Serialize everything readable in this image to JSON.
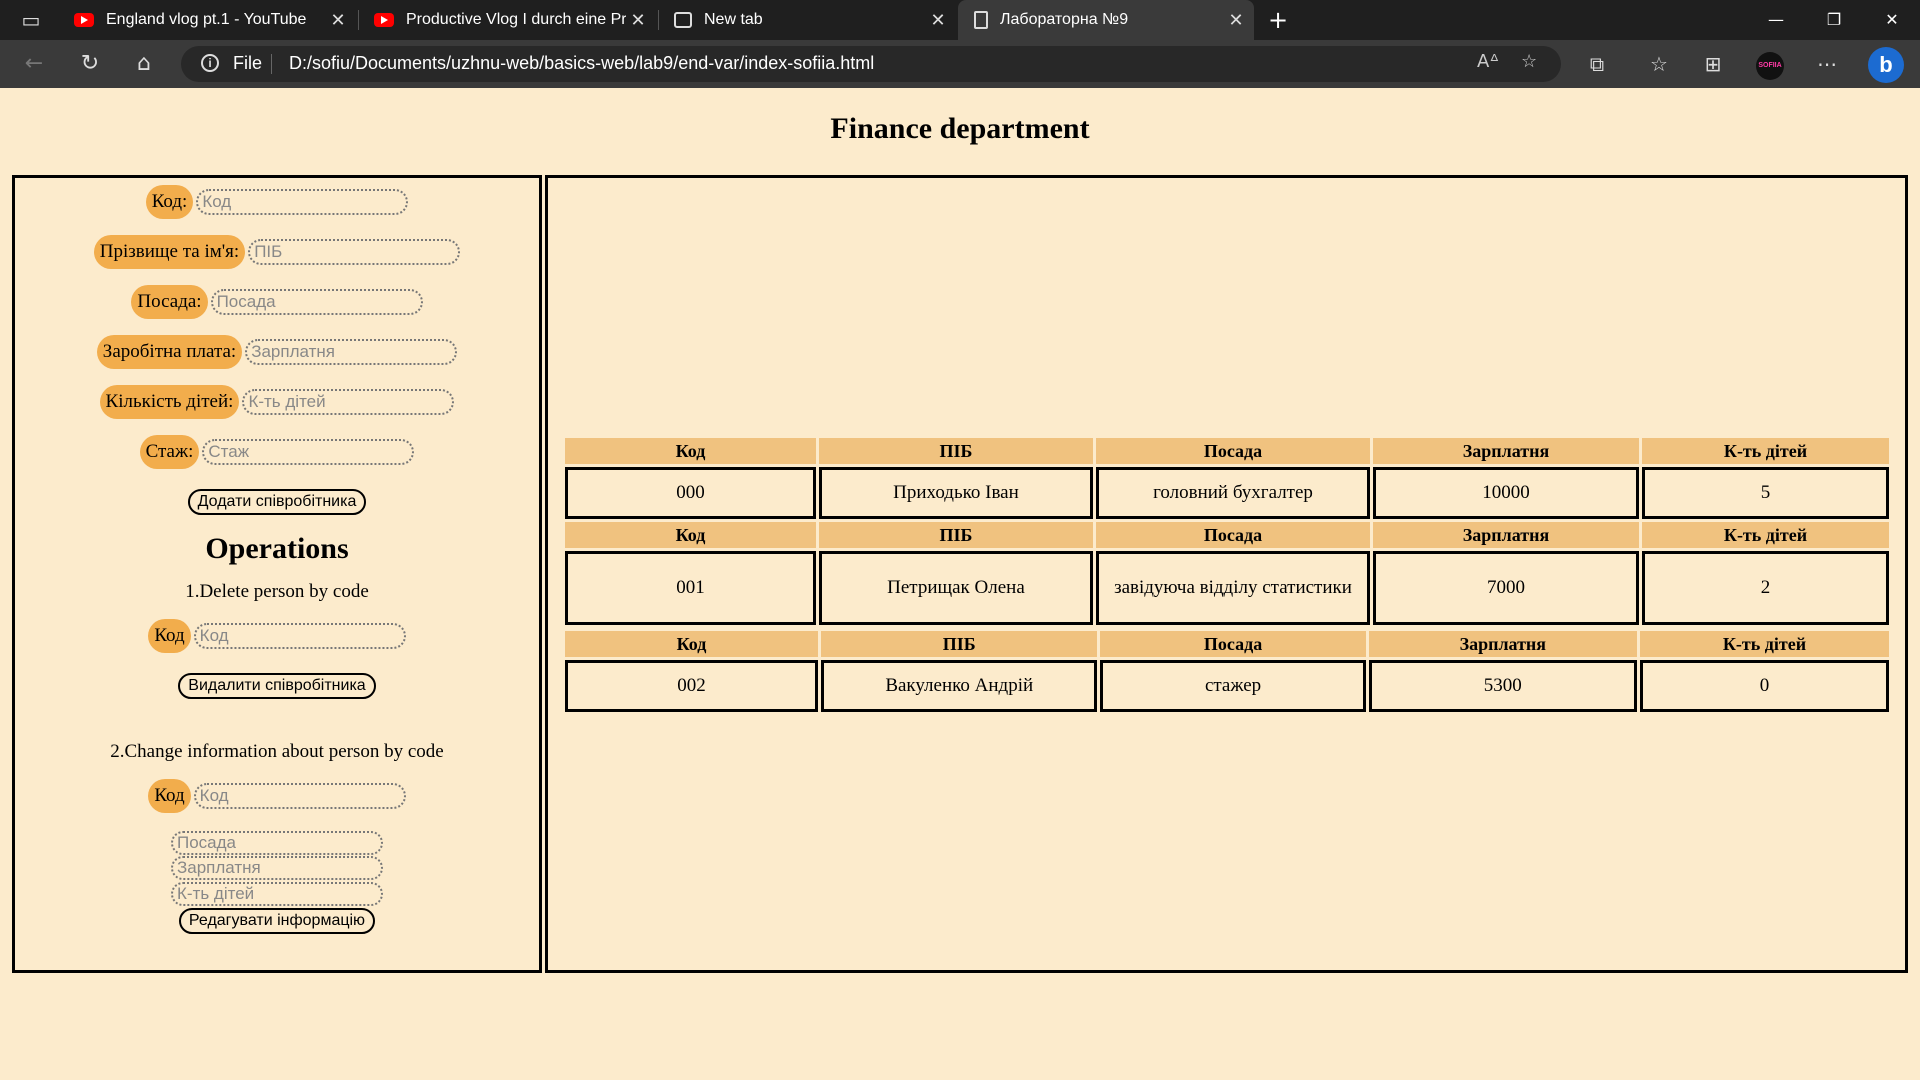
{
  "browser": {
    "tabs": [
      {
        "title": "England vlog pt.1 - YouTube",
        "icon": "youtube-icon"
      },
      {
        "title": "Productive Vlog I durch eine Prüf",
        "icon": "youtube-icon"
      },
      {
        "title": "New tab",
        "icon": "newtab-icon"
      },
      {
        "title": "Лабораторна №9",
        "icon": "document-icon"
      }
    ],
    "address": {
      "scheme": "File",
      "url": "D:/sofiu/Documents/uzhnu-web/basics-web/lab9/end-var/index-sofiia.html"
    },
    "profile_label": "SOFIIA"
  },
  "page": {
    "title": "Finance department",
    "form": {
      "fields": [
        {
          "label": "Код:",
          "placeholder": "Код"
        },
        {
          "label": "Прізвище та ім'я:",
          "placeholder": "ПІБ"
        },
        {
          "label": "Посада:",
          "placeholder": "Посада"
        },
        {
          "label": "Заробітна плата:",
          "placeholder": "Зарплатня"
        },
        {
          "label": "Кількість дітей:",
          "placeholder": "К-ть дітей"
        },
        {
          "label": "Стаж:",
          "placeholder": "Стаж"
        }
      ],
      "add_button": "Додати співробітника"
    },
    "operations": {
      "title": "Operations",
      "delete": {
        "caption": "1.Delete person by code",
        "label": "Код",
        "placeholder": "Код",
        "button": "Видалити співробітника"
      },
      "change": {
        "caption": "2.Change information about person by code",
        "label": "Код",
        "placeholder": "Код",
        "position_placeholder": "Посада",
        "salary_placeholder": "Зарплатня",
        "children_placeholder": "К-ть дітей",
        "button": "Редагувати інформацію"
      }
    },
    "table": {
      "headers": [
        "Код",
        "ПІБ",
        "Посада",
        "Зарплатня",
        "К-ть дітей"
      ],
      "rows": [
        [
          "000",
          "Приходько Іван",
          "головний бухгалтер",
          "10000",
          "5"
        ],
        [
          "001",
          "Петрищак Олена",
          "завідуюча відділу статистики",
          "7000",
          "2"
        ],
        [
          "002",
          "Вакуленко Андрій",
          "стажер",
          "5300",
          "0"
        ]
      ]
    }
  }
}
